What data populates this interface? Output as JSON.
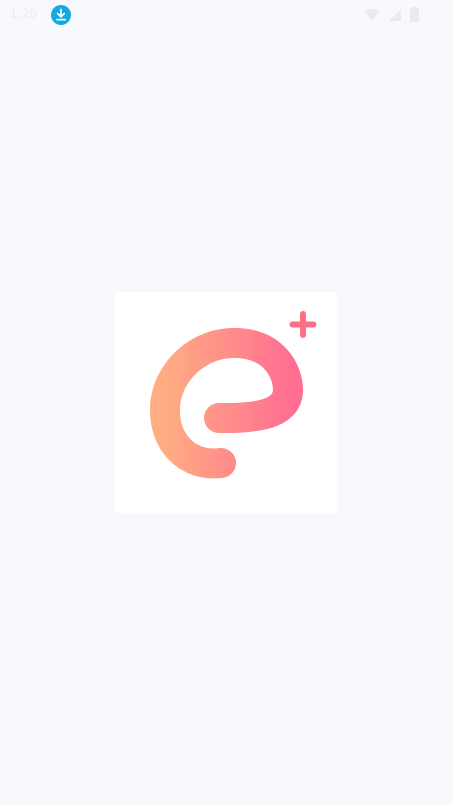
{
  "status_bar": {
    "time": "1:20",
    "icons": [
      "download-icon",
      "wifi-icon",
      "signal-icon",
      "battery-icon"
    ]
  },
  "splash": {
    "logo": "app-logo-icon",
    "colors": {
      "gradient_start": "#ffad82",
      "gradient_end": "#ff6f91",
      "plus": "#ff6f84",
      "download_badge": "#13a9e3"
    }
  }
}
